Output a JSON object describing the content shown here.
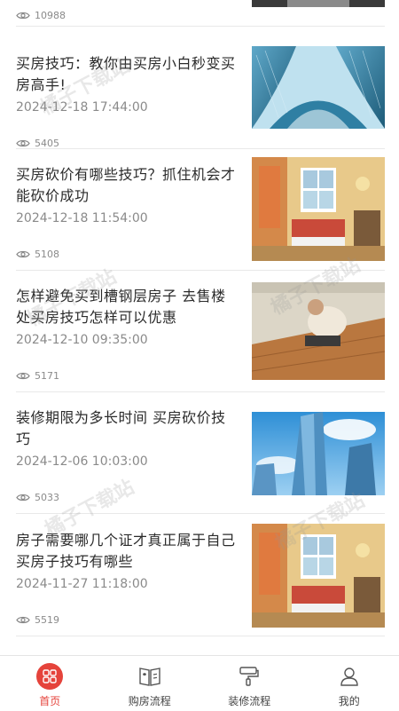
{
  "feed": {
    "top_item": {
      "views": "10988"
    },
    "articles": [
      {
        "title": "买房技巧：教你由买房小白秒变买房高手!",
        "date": "2024-12-18 17:44:00",
        "views": "5405",
        "image": "glass-towers"
      },
      {
        "title": "买房砍价有哪些技巧？抓住机会才能砍价成功",
        "date": "2024-12-18 11:54:00",
        "views": "5108",
        "image": "cozy-room"
      },
      {
        "title": "怎样避免买到槽钢层房子 去售楼处买房技巧怎样可以优惠",
        "date": "2024-12-10 09:35:00",
        "views": "5171",
        "image": "floor-installation"
      },
      {
        "title": "装修期限为多长时间 买房砍价技巧",
        "date": "2024-12-06 10:03:00",
        "views": "5033",
        "image": "skyscrapers"
      },
      {
        "title": "房子需要哪几个证才真正属于自己 买房子技巧有哪些",
        "date": "2024-11-27 11:18:00",
        "views": "5519",
        "image": "cozy-room"
      }
    ]
  },
  "tabbar": {
    "tabs": [
      {
        "label": "首页",
        "icon": "home-grid-icon",
        "active": true
      },
      {
        "label": "购房流程",
        "icon": "book-icon",
        "active": false
      },
      {
        "label": "装修流程",
        "icon": "paint-roller-icon",
        "active": false
      },
      {
        "label": "我的",
        "icon": "user-icon",
        "active": false
      }
    ]
  },
  "colors": {
    "accent": "#e5433b",
    "text": "#2b2b2b",
    "muted": "#8a8a8a",
    "divider": "#e9e9e9"
  },
  "watermark": "橘子下载站"
}
